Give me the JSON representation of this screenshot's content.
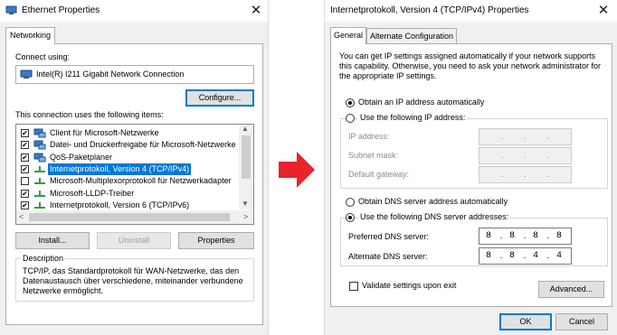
{
  "left_window": {
    "title": "Ethernet Properties",
    "tab": "Networking",
    "connect_using_label": "Connect using:",
    "adapter_name": "Intel(R) I211 Gigabit Network Connection",
    "configure_button": "Configure...",
    "items_label": "This connection uses the following items:",
    "items": [
      {
        "label": "Client für Microsoft-Netzwerke",
        "checked": true,
        "icon": "network-client-icon"
      },
      {
        "label": "Datei- und Druckerfreigabe für Microsoft-Netzwerke",
        "checked": true,
        "icon": "file-sharing-icon"
      },
      {
        "label": "QoS-Paketplaner",
        "checked": true,
        "icon": "qos-icon"
      },
      {
        "label": "Internetprotokoll, Version 4 (TCP/IPv4)",
        "checked": true,
        "selected": true,
        "icon": "protocol-icon"
      },
      {
        "label": "Microsoft-Multiplexorprotokoll für Netzwerkadapter",
        "checked": false,
        "icon": "protocol-icon"
      },
      {
        "label": "Microsoft-LLDP-Treiber",
        "checked": true,
        "icon": "protocol-icon"
      },
      {
        "label": "Internetprotokoll, Version 6 (TCP/IPv6)",
        "checked": true,
        "icon": "protocol-icon"
      }
    ],
    "install_button": "Install...",
    "uninstall_button": "Uninstall",
    "properties_button": "Properties",
    "description_title": "Description",
    "description_text": "TCP/IP, das Standardprotokoll für WAN-Netzwerke, das den Datenaustausch über verschiedene, miteinander verbundene Netzwerke ermöglicht."
  },
  "right_window": {
    "title": "Internetprotokoll, Version 4 (TCP/IPv4) Properties",
    "tabs": [
      "General",
      "Alternate Configuration"
    ],
    "intro_text": "You can get IP settings assigned automatically if your network supports this capability. Otherwise, you need to ask your network administrator for the appropriate IP settings.",
    "obtain_ip_auto": "Obtain an IP address automatically",
    "use_following_ip": "Use the following IP address:",
    "ip_address_label": "IP address:",
    "subnet_mask_label": "Subnet mask:",
    "default_gateway_label": "Default gateway:",
    "obtain_dns_auto": "Obtain DNS server address automatically",
    "use_following_dns": "Use the following DNS server addresses:",
    "preferred_dns_label": "Preferred DNS server:",
    "preferred_dns": [
      "8",
      "8",
      "8",
      "8"
    ],
    "alternate_dns_label": "Alternate DNS server:",
    "alternate_dns": [
      "8",
      "8",
      "4",
      "4"
    ],
    "validate_label": "Validate settings upon exit",
    "advanced_button": "Advanced...",
    "ok_button": "OK",
    "cancel_button": "Cancel"
  },
  "colors": {
    "arrow": "#e8232b",
    "selection": "#0078d7",
    "window_bg": "#f0f0f0"
  }
}
